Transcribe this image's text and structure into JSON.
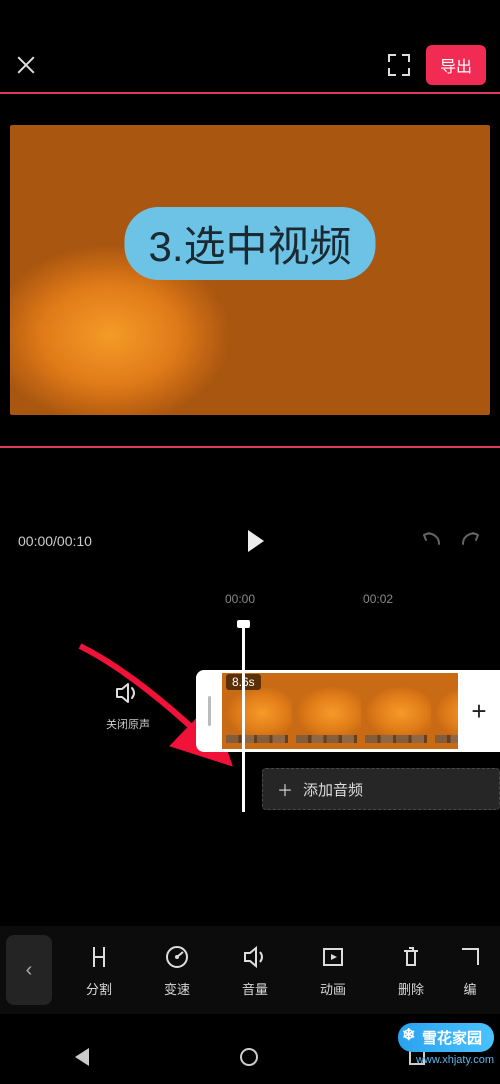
{
  "header": {
    "export_label": "导出"
  },
  "preview": {
    "caption": "3.选中视频"
  },
  "playback": {
    "time": "00:00/00:10"
  },
  "ruler": {
    "t0": "00:00",
    "t1": "00:02"
  },
  "timeline": {
    "mute_label": "关闭原声",
    "clip_duration": "8.6s",
    "add_audio_label": "添加音频"
  },
  "tools": {
    "back": "‹",
    "items": [
      {
        "label": "分割"
      },
      {
        "label": "变速"
      },
      {
        "label": "音量"
      },
      {
        "label": "动画"
      },
      {
        "label": "删除"
      },
      {
        "label": "编"
      }
    ]
  },
  "watermark": {
    "name": "雪花家园",
    "url": "www.xhjaty.com"
  }
}
